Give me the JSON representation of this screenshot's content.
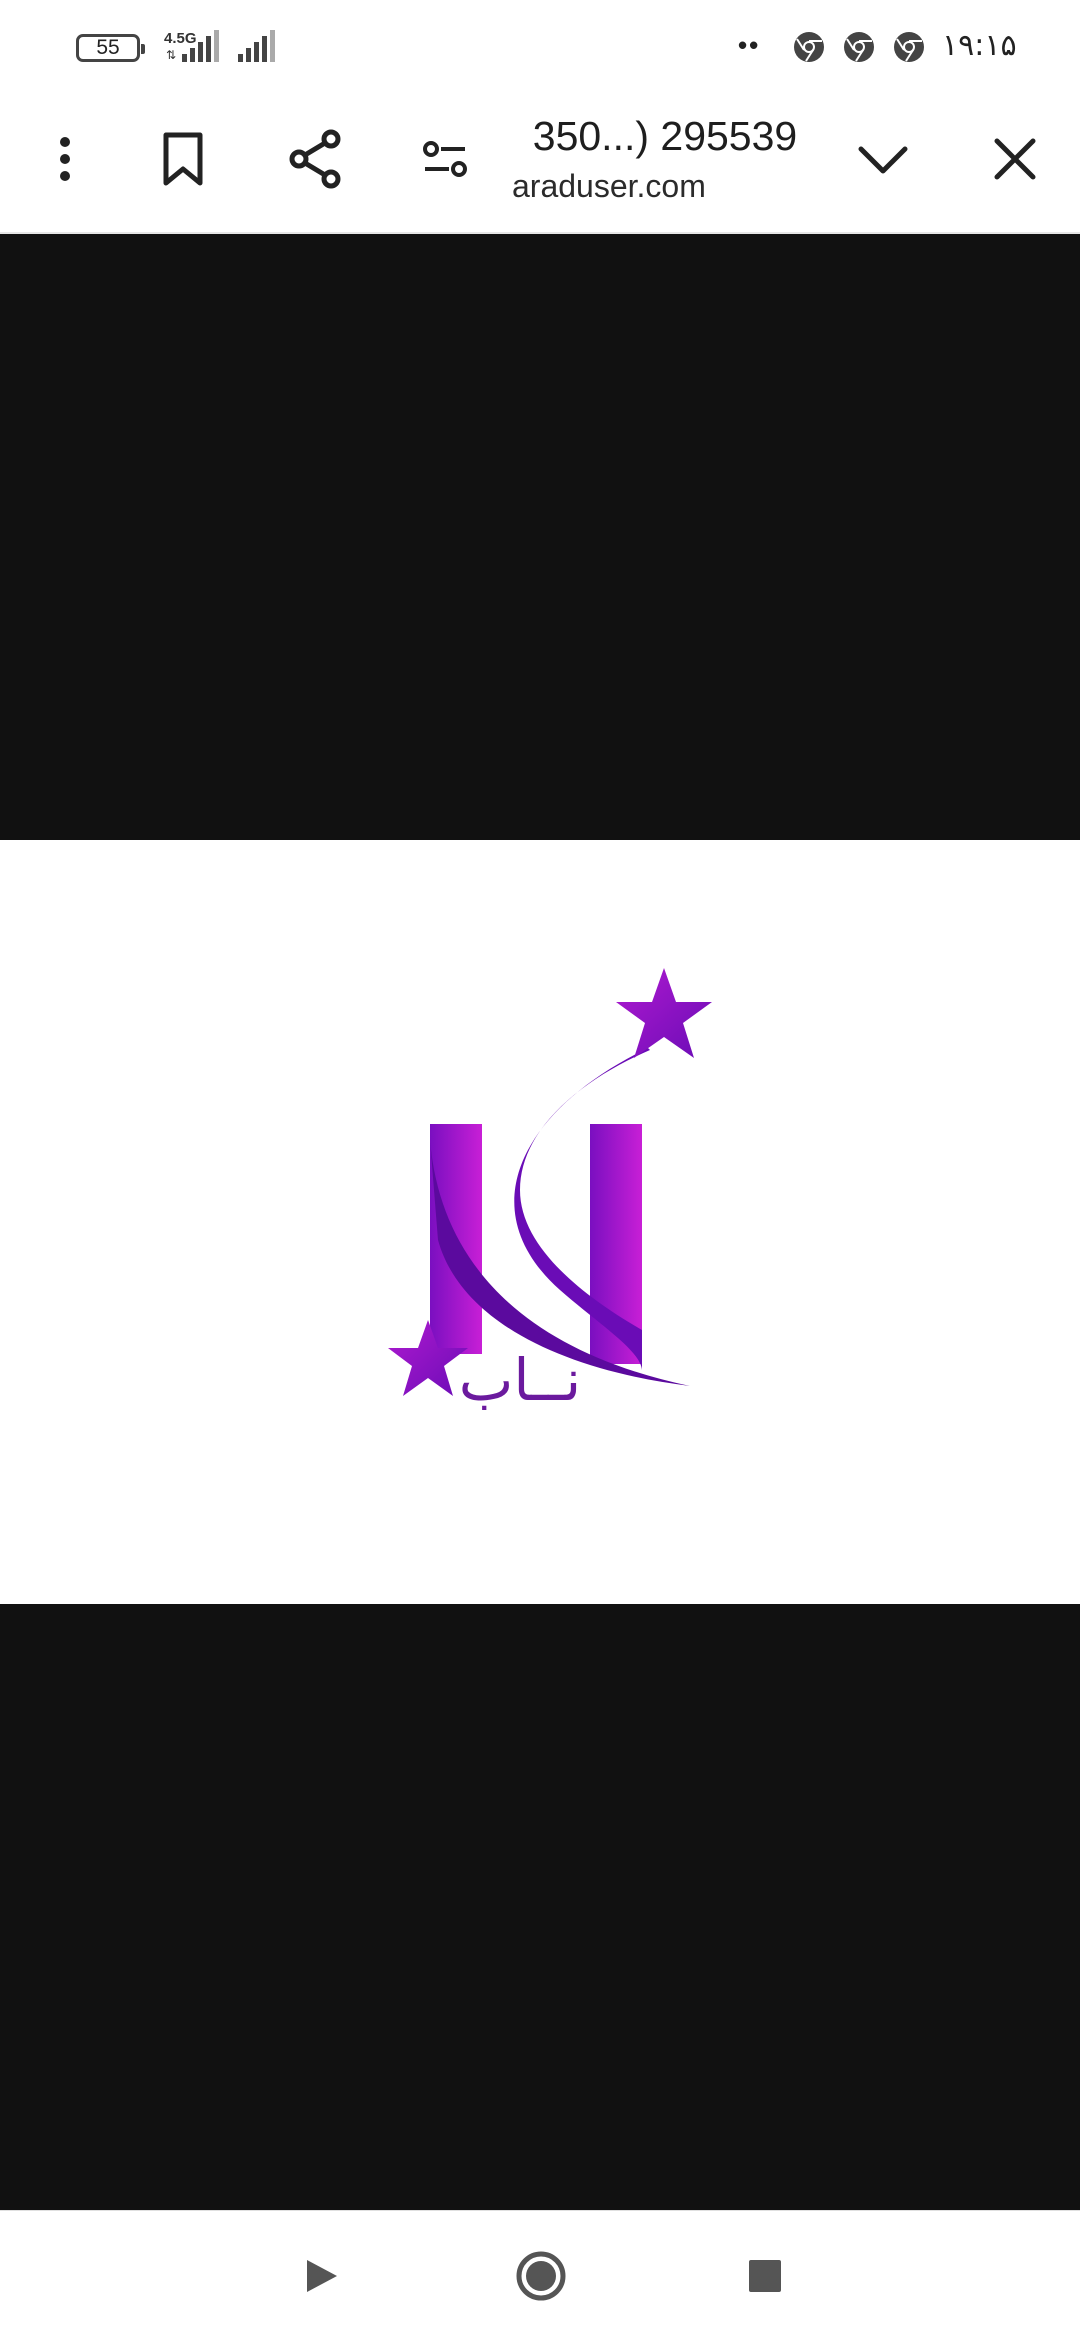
{
  "status_bar": {
    "battery_level": "55",
    "network_type": "4.5G",
    "network_arrows": "⇅",
    "dots": "••",
    "time": "۱۹:۱۵",
    "notification_icons": [
      "chrome-icon",
      "chrome-icon",
      "chrome-icon"
    ]
  },
  "toolbar": {
    "page_title": "350...) 295539",
    "page_url": "araduser.com",
    "icons": [
      "more-vert-icon",
      "bookmark-icon",
      "share-icon",
      "tune-icon",
      "chevron-down-icon",
      "close-icon"
    ]
  },
  "content": {
    "logo_text": "نــاب",
    "logo_colors": {
      "primary": "#7a0fc0",
      "accent": "#c81fd6",
      "dark": "#5b0a9e"
    }
  },
  "nav_bar": {
    "icons": [
      "back-triangle-icon",
      "home-circle-icon",
      "recents-square-icon"
    ]
  }
}
